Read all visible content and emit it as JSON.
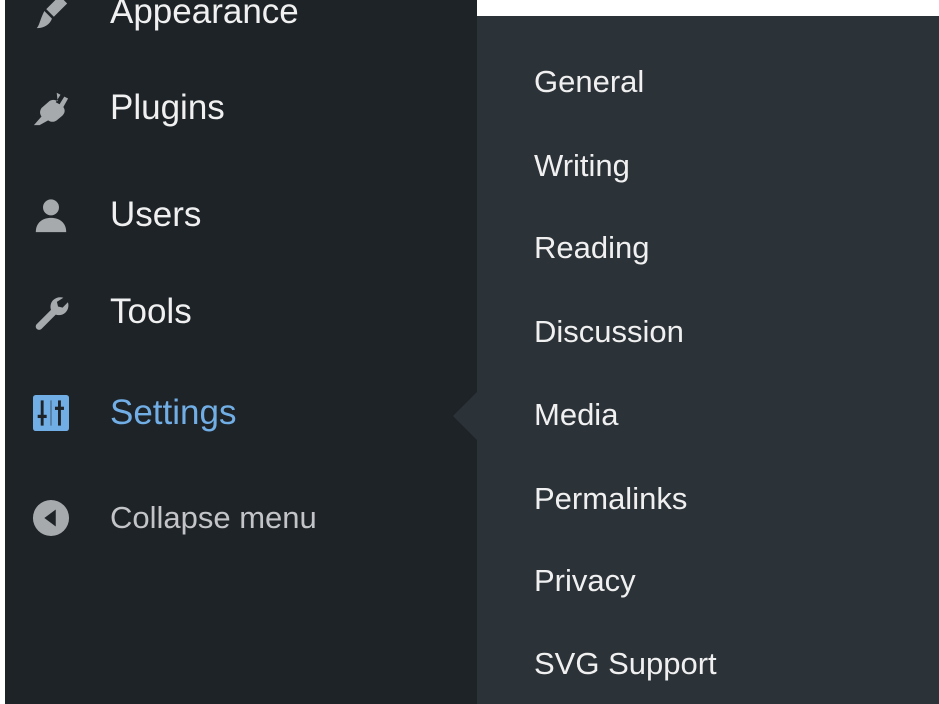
{
  "admin_menu": {
    "items": [
      {
        "label": "Appearance",
        "icon": "paintbrush-icon"
      },
      {
        "label": "Plugins",
        "icon": "plugin-icon"
      },
      {
        "label": "Users",
        "icon": "users-icon"
      },
      {
        "label": "Tools",
        "icon": "wrench-icon"
      },
      {
        "label": "Settings",
        "icon": "settings-sliders-icon",
        "current": true
      },
      {
        "label": "Collapse menu",
        "icon": "collapse-arrow-icon"
      }
    ]
  },
  "settings_submenu": {
    "items": [
      "General",
      "Writing",
      "Reading",
      "Discussion",
      "Media",
      "Permalinks",
      "Privacy",
      "SVG Support"
    ]
  },
  "colors": {
    "menu_background": "#1d2327",
    "submenu_background": "#2c3338",
    "menu_text": "#f0f0f1",
    "current_item_text": "#72aee6",
    "icon_gray": "#a7aaad"
  }
}
